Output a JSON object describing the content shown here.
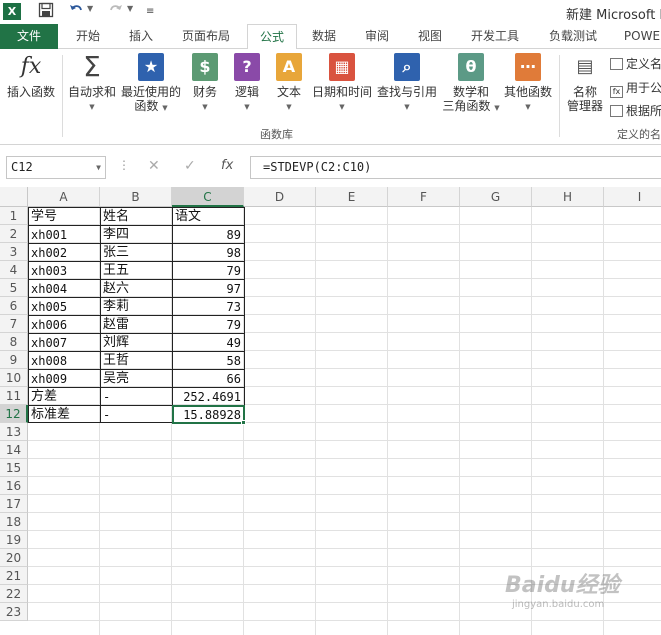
{
  "window": {
    "title": "新建 Microsoft E"
  },
  "quick_access": {
    "icons": [
      "excel-logo-icon",
      "save-icon",
      "undo-icon",
      "redo-icon",
      "customize-icon"
    ]
  },
  "tabs": [
    "文件",
    "开始",
    "插入",
    "页面布局",
    "公式",
    "数据",
    "审阅",
    "视图",
    "开发工具",
    "负载测试",
    "POWE"
  ],
  "active_tab": "公式",
  "ribbon": {
    "function_library": {
      "insert_function": "插入函数",
      "autosum": "自动求和",
      "recent_1": "最近使用的",
      "recent_2": "函数",
      "financial": "财务",
      "logical": "逻辑",
      "text": "文本",
      "datetime": "日期和时间",
      "lookup": "查找与引用",
      "math_1": "数学和",
      "math_2": "三角函数",
      "more": "其他函数",
      "group_label": "函数库"
    },
    "defined_names": {
      "name_manager_1": "名称",
      "name_manager_2": "管理器",
      "define_name": "定义名",
      "use_in_formula": "用于公",
      "create_from": "根据所",
      "group_label": "定义的名"
    }
  },
  "formula_bar": {
    "name_box": "C12",
    "formula": "=STDEVP(C2:C10)",
    "fx": "fx"
  },
  "columns": [
    "A",
    "B",
    "C",
    "D",
    "E",
    "F",
    "G",
    "H",
    "I"
  ],
  "rows": [
    "1",
    "2",
    "3",
    "4",
    "5",
    "6",
    "7",
    "8",
    "9",
    "10",
    "11",
    "12",
    "13",
    "14",
    "15",
    "16",
    "17",
    "18",
    "19",
    "20",
    "21",
    "22",
    "23"
  ],
  "cells": [
    [
      "学号",
      "姓名",
      "语文"
    ],
    [
      "xh001",
      "李四",
      "89"
    ],
    [
      "xh002",
      "张三",
      "98"
    ],
    [
      "xh003",
      "王五",
      "79"
    ],
    [
      "xh004",
      "赵六",
      "97"
    ],
    [
      "xh005",
      "李莉",
      "73"
    ],
    [
      "xh006",
      "赵雷",
      "79"
    ],
    [
      "xh007",
      "刘辉",
      "49"
    ],
    [
      "xh008",
      "王哲",
      "58"
    ],
    [
      "xh009",
      "吴亮",
      "66"
    ],
    [
      "方差",
      "-",
      "252.4691"
    ],
    [
      "标准差",
      "-",
      "15.88928"
    ]
  ],
  "selected_cell": "C12",
  "watermark": {
    "main": "Baidu经验",
    "sub": "jingyan.baidu.com"
  }
}
